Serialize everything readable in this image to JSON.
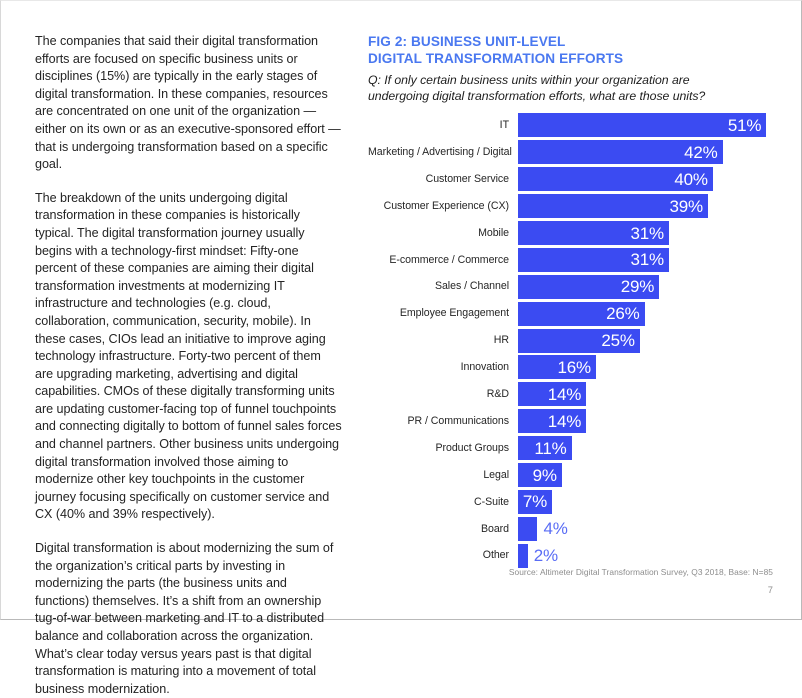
{
  "document": {
    "page_number": "7",
    "source_note": "Source: Altimeter Digital Transformation Survey, Q3 2018, Base: N=85"
  },
  "article": {
    "paragraphs": [
      "The companies that said their digital transformation efforts are focused on specific business units or disciplines (15%) are typically in the early stages of digital transformation. In these companies, resources are concentrated on one unit of the organization — either on its own or as an executive-sponsored effort — that is undergoing transformation based on a specific goal.",
      "The breakdown of the units undergoing digital transformation in these companies is historically typical. The digital transformation journey usually begins with a technology-first mindset: Fifty-one percent of these companies are aiming their digital transformation investments at modernizing IT infrastructure and technologies (e.g. cloud, collaboration, communication, security, mobile). In these cases, CIOs lead an initiative to improve aging technology infrastructure. Forty-two percent of them are upgrading marketing, advertising and digital capabilities. CMOs of these digitally transforming units are updating customer-facing top of funnel touchpoints and connecting digitally to bottom of funnel sales forces and channel partners. Other business units undergoing digital transformation involved those aiming to modernize other key touchpoints in the customer journey focusing specifically on customer service and CX (40% and 39% respectively).",
      "Digital transformation is about modernizing the sum of the organization’s critical parts by investing in modernizing the parts (the business units and functions) themselves. It’s a shift from an ownership tug-of-war between marketing and IT to a distributed balance and collaboration across the organization. What’s clear today versus years past is that digital transformation is maturing into a movement of total business modernization."
    ]
  },
  "figure": {
    "title_line1": "FIG 2: BUSINESS UNIT-LEVEL",
    "title_line2": "DIGITAL TRANSFORMATION EFFORTS",
    "question": "Q: If only certain business units within your organization are undergoing digital transformation efforts, what are those units?"
  },
  "chart_data": {
    "type": "bar",
    "orientation": "horizontal",
    "title": "FIG 2: BUSINESS UNIT-LEVEL DIGITAL TRANSFORMATION EFFORTS",
    "subtitle": "Q: If only certain business units within your organization are undergoing digital transformation efforts, what are those units?",
    "xlabel": "",
    "ylabel": "",
    "xlim": [
      0,
      51
    ],
    "grid": false,
    "legend": false,
    "bar_color": "#3b4bf2",
    "label_inside_color": "#ffffff",
    "label_outside_color": "#5a6df5",
    "value_suffix": "%",
    "source": "Source: Altimeter Digital Transformation Survey, Q3 2018, Base: N=85",
    "categories": [
      "IT",
      "Marketing / Advertising / Digital",
      "Customer Service",
      "Customer Experience (CX)",
      "Mobile",
      "E-commerce / Commerce",
      "Sales / Channel",
      "Employee Engagement",
      "HR",
      "Innovation",
      "R&D",
      "PR / Communications",
      "Product Groups",
      "Legal",
      "C-Suite",
      "Board",
      "Other"
    ],
    "values": [
      51,
      42,
      40,
      39,
      31,
      31,
      29,
      26,
      25,
      16,
      14,
      14,
      11,
      9,
      7,
      4,
      2
    ],
    "value_labels": [
      "51%",
      "42%",
      "40%",
      "39%",
      "31%",
      "31%",
      "29%",
      "26%",
      "25%",
      "16%",
      "14%",
      "14%",
      "11%",
      "9%",
      "7%",
      "4%",
      "2%"
    ],
    "label_placement": [
      "inside",
      "inside",
      "inside",
      "inside",
      "inside",
      "inside",
      "inside",
      "inside",
      "inside",
      "inside",
      "inside",
      "inside",
      "inside",
      "inside",
      "inside",
      "outside",
      "outside"
    ]
  }
}
